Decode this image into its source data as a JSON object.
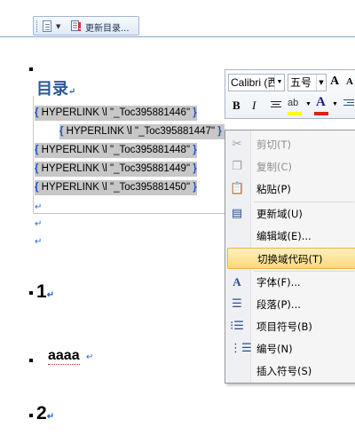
{
  "toc_toolbar": {
    "update_label": "更新目录..."
  },
  "toc": {
    "title": "目录",
    "entries": [
      {
        "text": " HYPERLINK \\l \"_Toc395881446\" "
      },
      {
        "text": " HYPERLINK \\l \"_Toc395881447\" "
      },
      {
        "text": " HYPERLINK \\l \"_Toc395881448\" "
      },
      {
        "text": " HYPERLINK \\l \"_Toc395881449\" "
      },
      {
        "text": " HYPERLINK \\l \"_Toc395881450\" "
      }
    ]
  },
  "document": {
    "heading1": "1",
    "body_text": "aaaa",
    "heading2": "2"
  },
  "mini_toolbar": {
    "font_name": "Calibri (西",
    "font_size": "五号",
    "grow_font": "A",
    "shrink_font": "A",
    "bold": "B",
    "italic": "I",
    "highlight": "ab",
    "font_color": "A",
    "highlight_color": "#ffff00",
    "font_color_bar": "#e02020"
  },
  "context_menu": {
    "items": [
      {
        "label": "剪切(T)",
        "icon": "scissors-icon",
        "enabled": false
      },
      {
        "label": "复制(C)",
        "icon": "copy-icon",
        "enabled": false
      },
      {
        "label": "粘贴(P)",
        "icon": "paste-icon",
        "enabled": true
      },
      {
        "label": "更新域(U)",
        "icon": "update-field-icon",
        "enabled": true
      },
      {
        "label": "编辑域(E)...",
        "icon": "",
        "enabled": true
      },
      {
        "label": "切换域代码(T)",
        "icon": "",
        "enabled": true,
        "highlighted": true
      },
      {
        "label": "字体(F)...",
        "icon": "font-icon",
        "enabled": true
      },
      {
        "label": "段落(P)...",
        "icon": "paragraph-icon",
        "enabled": true
      },
      {
        "label": "项目符号(B)",
        "icon": "bullets-icon",
        "enabled": true
      },
      {
        "label": "编号(N)",
        "icon": "numbering-icon",
        "enabled": true
      },
      {
        "label": "插入符号(S)",
        "icon": "",
        "enabled": true
      }
    ]
  }
}
